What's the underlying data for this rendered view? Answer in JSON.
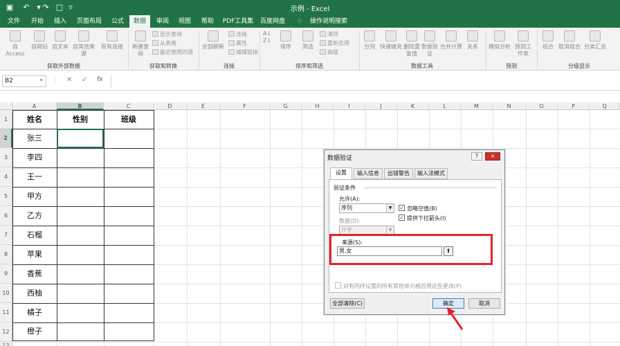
{
  "window": {
    "title": "示例 - Excel"
  },
  "quick_access": {
    "save_icon": "save-icon",
    "undo_icon": "undo-icon",
    "redo_icon": "redo-icon",
    "new_icon": "new-file-icon",
    "customize_icon": "chevron-down-icon"
  },
  "tabs": [
    "文件",
    "开始",
    "插入",
    "页面布局",
    "公式",
    "数据",
    "审阅",
    "视图",
    "帮助",
    "PDF工具集",
    "百度网盘",
    "操作说明搜索"
  ],
  "active_tab": "数据",
  "ribbon": {
    "groups": [
      {
        "label": "获取外部数据",
        "buttons": [
          "自 Access",
          "自网站",
          "自文本",
          "自其他来源",
          "现有连接"
        ]
      },
      {
        "label": "获取和转换",
        "buttons": [
          "新建查询"
        ],
        "small": [
          "显示查询",
          "从表格",
          "最近使用的源"
        ]
      },
      {
        "label": "连接",
        "buttons": [
          "全部刷新"
        ],
        "small": [
          "连接",
          "属性",
          "编辑链接"
        ]
      },
      {
        "label": "排序和筛选",
        "buttons": [
          "排序",
          "筛选"
        ],
        "small": [
          "清除",
          "重新应用",
          "高级"
        ]
      },
      {
        "label": "数据工具",
        "buttons": [
          "分列",
          "快速填充",
          "删除重复值",
          "数据验证",
          "合并计算",
          "关系"
        ]
      },
      {
        "label": "预测",
        "buttons": [
          "模拟分析",
          "预测工作表"
        ]
      },
      {
        "label": "分级显示",
        "buttons": [
          "组合",
          "取消组合",
          "分类汇总"
        ]
      }
    ]
  },
  "formula_bar": {
    "name_box": "B2",
    "fx": "fx"
  },
  "columns": [
    "A",
    "B",
    "C",
    "D",
    "E",
    "F",
    "G",
    "H",
    "I",
    "J",
    "K",
    "L",
    "M",
    "N",
    "O",
    "P",
    "Q"
  ],
  "rows": [
    "1",
    "2",
    "3",
    "4",
    "5",
    "6",
    "7",
    "8",
    "9",
    "10",
    "11",
    "12",
    "13"
  ],
  "headers": [
    "姓名",
    "性别",
    "班级"
  ],
  "names": [
    "张三",
    "李四",
    "王一",
    "甲方",
    "乙方",
    "石榴",
    "苹果",
    "香蕉",
    "西柚",
    "橘子",
    "橙子"
  ],
  "dialog": {
    "title": "数据验证",
    "help": "?",
    "close": "×",
    "tabs": [
      "设置",
      "输入信息",
      "出错警告",
      "输入法模式"
    ],
    "section": "验证条件",
    "allow_label": "允许(A):",
    "allow_value": "序列",
    "data_label": "数据(D):",
    "data_value": "介于",
    "ignore_blank": "忽略空值(B)",
    "dropdown": "提供下拉箭头(I)",
    "source_label": "来源(S):",
    "source_value": "男,女",
    "apply_all": "对有同样设置的所有其他单元格应用这些更改(P)",
    "clear_all": "全部清除(C)",
    "ok": "确定",
    "cancel": "取消"
  },
  "colors": {
    "accent": "#217346",
    "highlight": "#e8202a"
  }
}
